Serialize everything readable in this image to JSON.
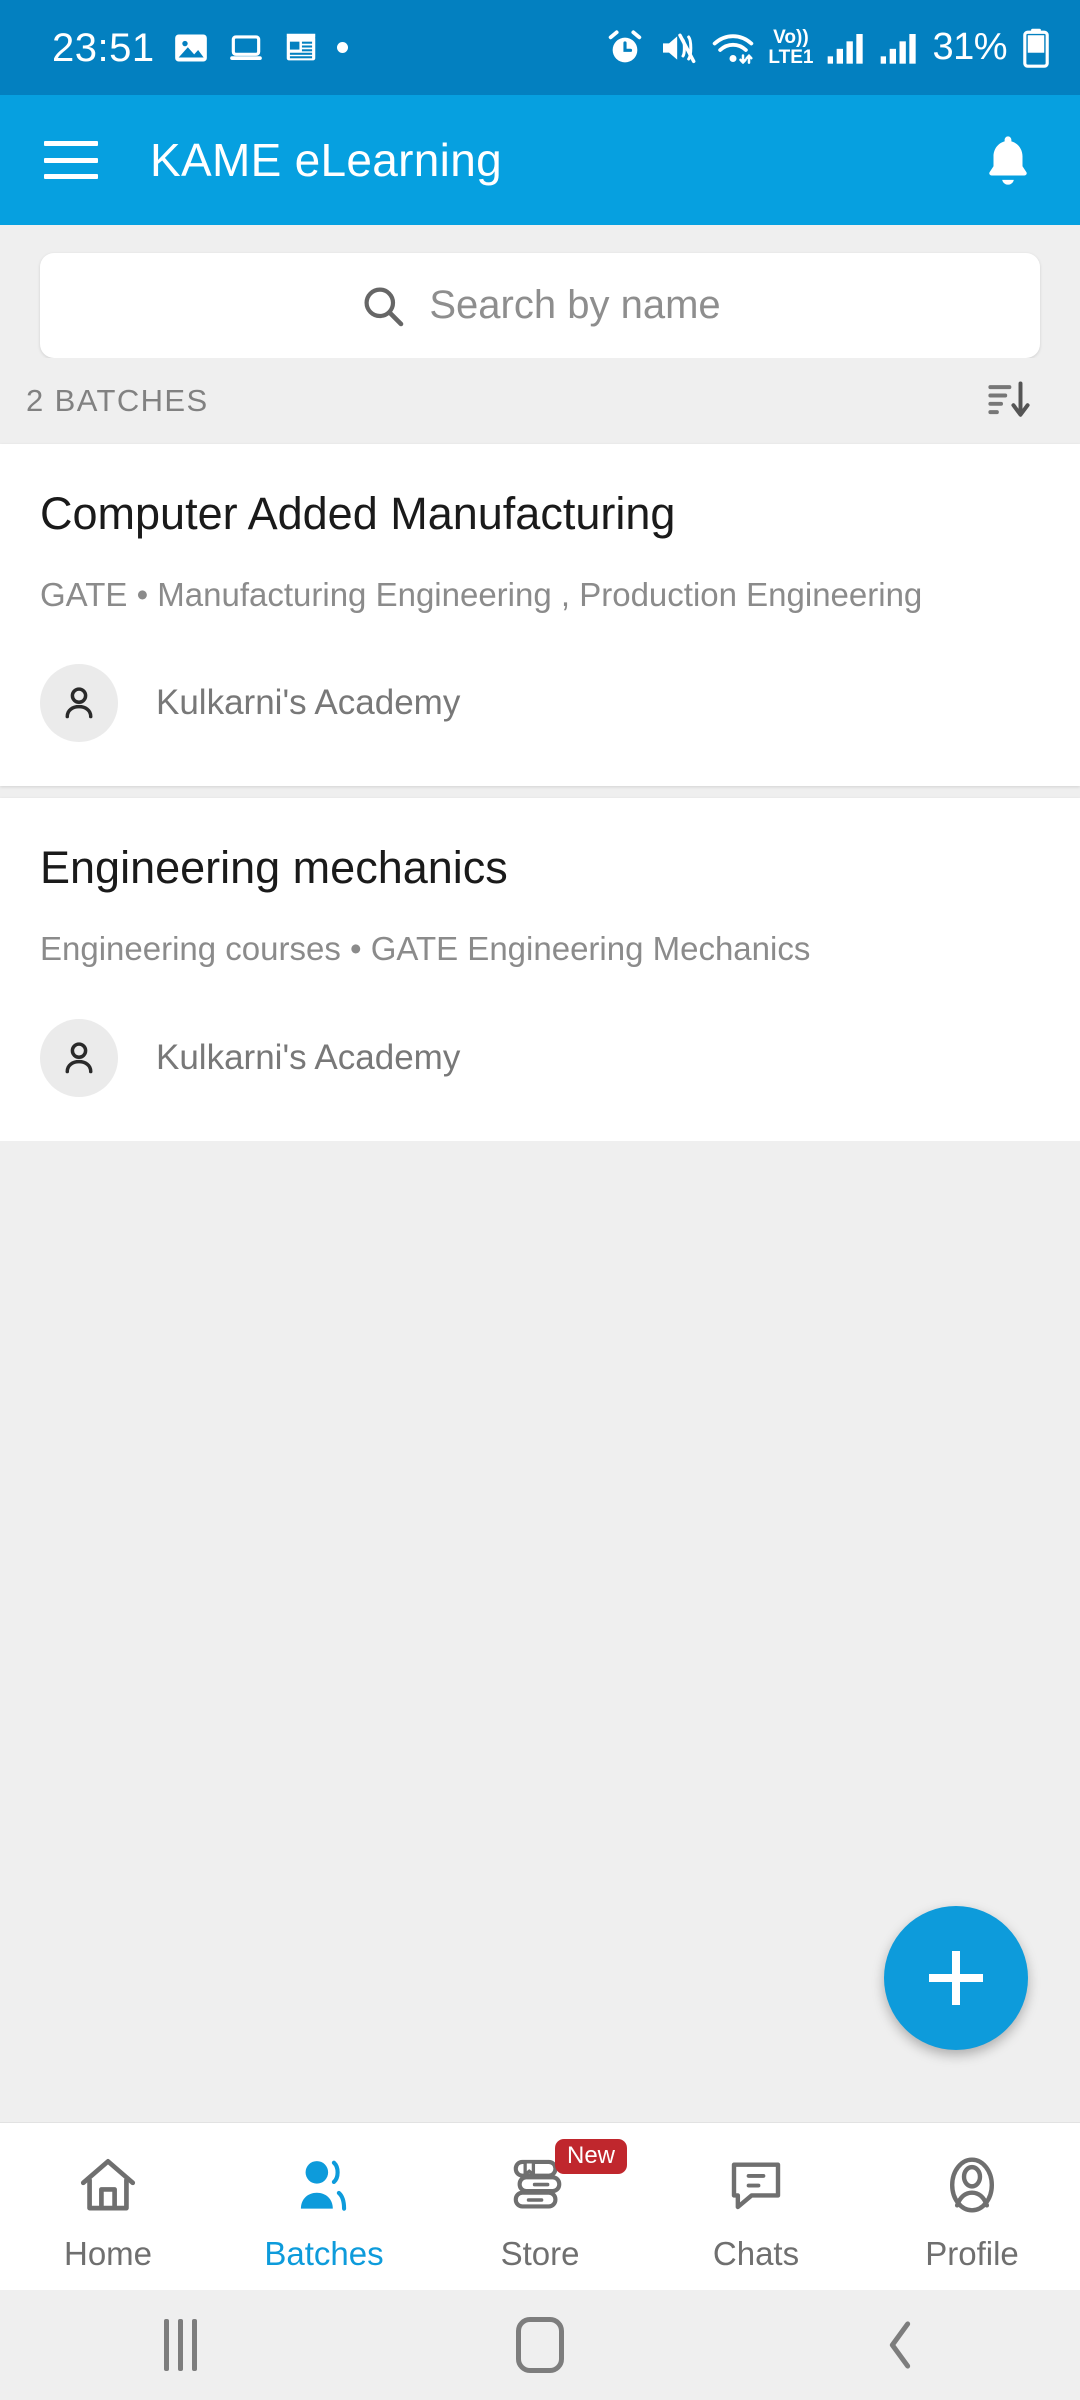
{
  "statusbar": {
    "time": "23:51",
    "left_icons": [
      "gallery-icon",
      "laptop-icon",
      "news-icon",
      "dot-indicator"
    ],
    "right_icons": [
      "alarm-icon",
      "mute-vibrate-icon",
      "wifi-icon"
    ],
    "volte_line1": "Vo))",
    "volte_line2": "LTE1",
    "battery_percent": "31%",
    "bg_color": "#0380c0"
  },
  "appbar": {
    "menu_icon": "hamburger-menu-icon",
    "title": "KAME eLearning",
    "notification_icon": "bell-icon",
    "bg_color": "#06a0e0"
  },
  "search": {
    "icon": "search-icon",
    "placeholder": "Search by name",
    "value": ""
  },
  "list_header": {
    "count_label": "2 BATCHES",
    "sort_icon": "sort-descending-icon"
  },
  "batches": [
    {
      "title": "Computer Added Manufacturing",
      "subtitle": "GATE • Manufacturing Engineering , Production Engineering",
      "owner": "Kulkarni's Academy",
      "avatar_icon": "person-icon"
    },
    {
      "title": "Engineering mechanics",
      "subtitle": "Engineering courses • GATE Engineering Mechanics",
      "owner": "Kulkarni's Academy",
      "avatar_icon": "person-icon"
    }
  ],
  "fab": {
    "icon": "plus-icon",
    "label": "+",
    "color": "#0d9bdb"
  },
  "bottomnav": {
    "active_color": "#0d9bdb",
    "inactive_color": "#6f6f6f",
    "badge_color": "#c0272d",
    "items": [
      {
        "label": "Home",
        "icon": "home-icon",
        "active": false,
        "badge": ""
      },
      {
        "label": "Batches",
        "icon": "batches-icon",
        "active": true,
        "badge": ""
      },
      {
        "label": "Store",
        "icon": "books-icon",
        "active": false,
        "badge": "New"
      },
      {
        "label": "Chats",
        "icon": "chat-icon",
        "active": false,
        "badge": ""
      },
      {
        "label": "Profile",
        "icon": "profile-icon",
        "active": false,
        "badge": ""
      }
    ]
  },
  "sysnav": {
    "recents_icon": "recents-icon",
    "home_icon": "home-square-icon",
    "back_icon": "back-chevron-icon"
  }
}
